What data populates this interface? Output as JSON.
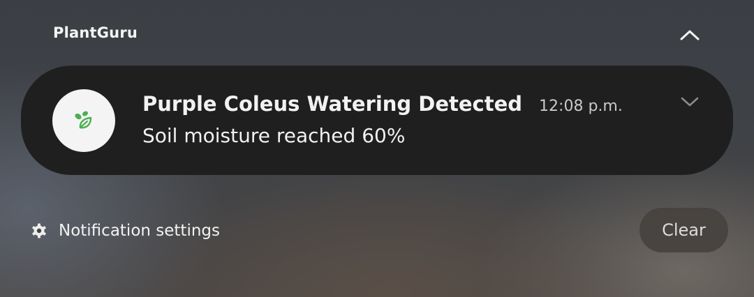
{
  "group": {
    "app_name": "PlantGuru",
    "collapse_icon": "chevron-up-icon"
  },
  "notification": {
    "app_icon": "plant-leaf-icon",
    "title": "Purple Coleus Watering Detected",
    "time": "12:08 p.m.",
    "body": "Soil moisture reached 60%",
    "expand_icon": "chevron-down-icon"
  },
  "footer": {
    "settings_icon": "gear-icon",
    "settings_label": "Notification settings",
    "clear_label": "Clear"
  },
  "colors": {
    "card_background": "#1f1f1f",
    "icon_accent": "#4caf50",
    "icon_background": "#f4f4f4"
  }
}
